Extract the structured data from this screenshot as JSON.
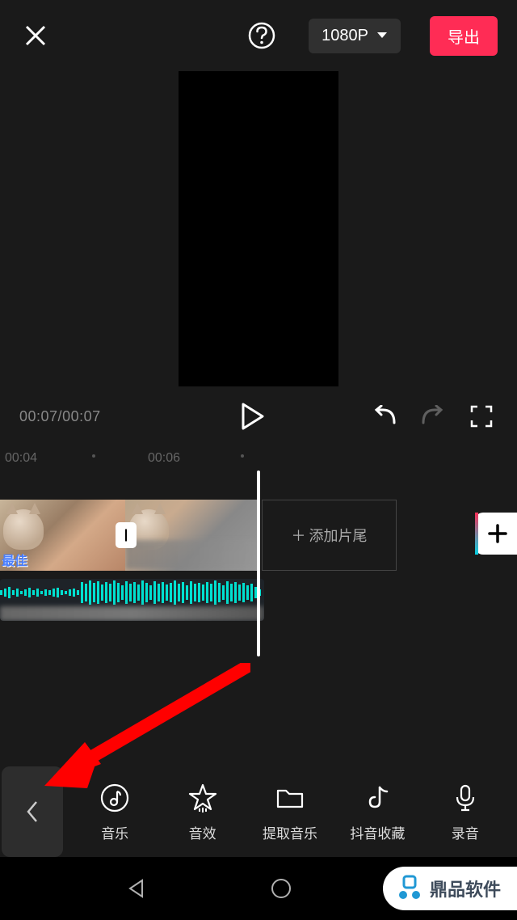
{
  "topBar": {
    "resolution": "1080P",
    "export": "导出"
  },
  "player": {
    "currentTime": "00:07",
    "totalTime": "00:07"
  },
  "ruler": {
    "labels": [
      "00:04",
      "00:06"
    ]
  },
  "timeline": {
    "clip1Text": "最佳",
    "transitionLabel": "|",
    "addEnding": "添加片尾"
  },
  "tools": {
    "items": [
      {
        "label": "音乐"
      },
      {
        "label": "音效"
      },
      {
        "label": "提取音乐"
      },
      {
        "label": "抖音收藏"
      },
      {
        "label": "录音"
      }
    ]
  },
  "watermark": {
    "text": "鼎品软件"
  }
}
